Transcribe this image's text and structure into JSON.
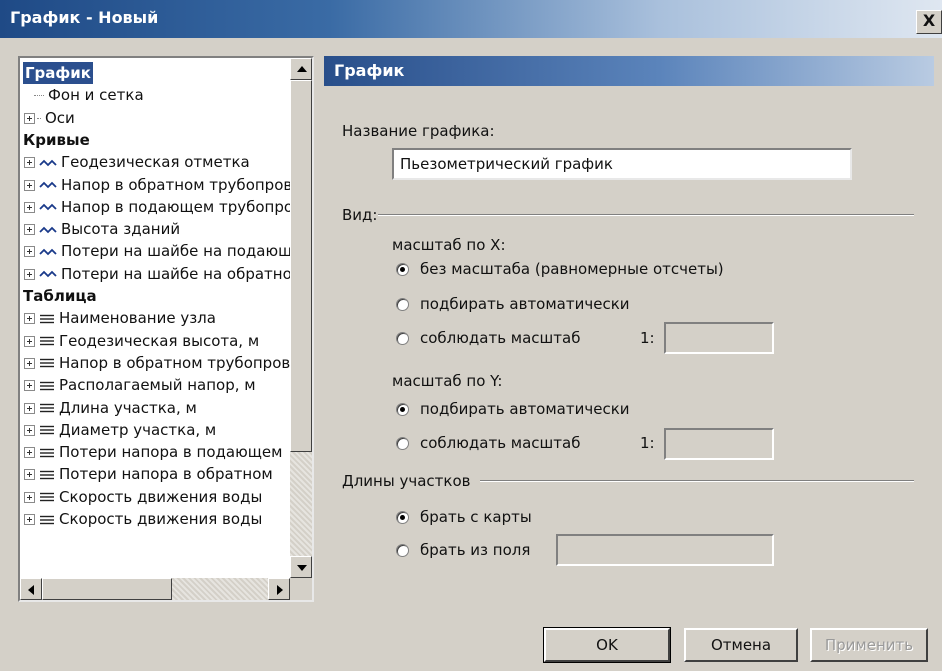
{
  "window": {
    "title": "График - Новый",
    "close_label": "X"
  },
  "tree": {
    "items": [
      {
        "label": "График",
        "kind": "header",
        "selected": true
      },
      {
        "label": "Фон и сетка",
        "kind": "leaf"
      },
      {
        "label": "Оси",
        "kind": "expandable"
      },
      {
        "label": "Кривые",
        "kind": "header"
      },
      {
        "label": "Геодезическая отметка",
        "kind": "curve"
      },
      {
        "label": "Напор в обратном трубопроводе",
        "kind": "curve"
      },
      {
        "label": "Напор в подающем трубопроводе",
        "kind": "curve"
      },
      {
        "label": "Высота зданий",
        "kind": "curve"
      },
      {
        "label": "Потери на шайбе на подающем",
        "kind": "curve"
      },
      {
        "label": "Потери на шайбе на обратном",
        "kind": "curve"
      },
      {
        "label": "Таблица",
        "kind": "header"
      },
      {
        "label": "Наименование узла",
        "kind": "table"
      },
      {
        "label": "Геодезическая высота, м",
        "kind": "table"
      },
      {
        "label": "Напор в обратном трубопроводе",
        "kind": "table"
      },
      {
        "label": "Располагаемый напор, м",
        "kind": "table"
      },
      {
        "label": "Длина участка, м",
        "kind": "table"
      },
      {
        "label": "Диаметр участка, м",
        "kind": "table"
      },
      {
        "label": "Потери напора в подающем",
        "kind": "table"
      },
      {
        "label": "Потери напора в обратном",
        "kind": "table"
      },
      {
        "label": "Скорость движения воды",
        "kind": "table"
      },
      {
        "label": "Скорость движения воды",
        "kind": "table"
      }
    ]
  },
  "panel": {
    "title": "График",
    "name_label": "Название графика:",
    "name_value": "Пьезометрический график",
    "view_group": "Вид:",
    "scale_x_label": "масштаб по X:",
    "scale_x_options": [
      "без масштаба (равномерные отсчеты)",
      "подбирать автоматически",
      "соблюдать масштаб"
    ],
    "scale_x_selected": 0,
    "ratio_prefix": "1:",
    "scale_y_label": "масштаб по Y:",
    "scale_y_options": [
      "подбирать автоматически",
      "соблюдать масштаб"
    ],
    "scale_y_selected": 0,
    "lengths_group": "Длины участков",
    "lengths_options": [
      "брать с карты",
      "брать из поля"
    ],
    "lengths_selected": 0
  },
  "buttons": {
    "ok": "OK",
    "cancel": "Отмена",
    "apply": "Применить"
  }
}
